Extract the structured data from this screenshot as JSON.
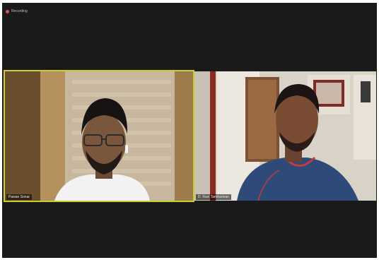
{
  "meeting": {
    "recording_label": "Recording"
  },
  "participants": [
    {
      "name": "Pawan Sonar",
      "active_speaker": true
    },
    {
      "name": "D. Ravi Tamilselvan",
      "active_speaker": false
    }
  ],
  "colors": {
    "window_bg": "#1a1a1a",
    "active_speaker_border": "#c9cf2f",
    "recording_dot": "#d9534f"
  }
}
